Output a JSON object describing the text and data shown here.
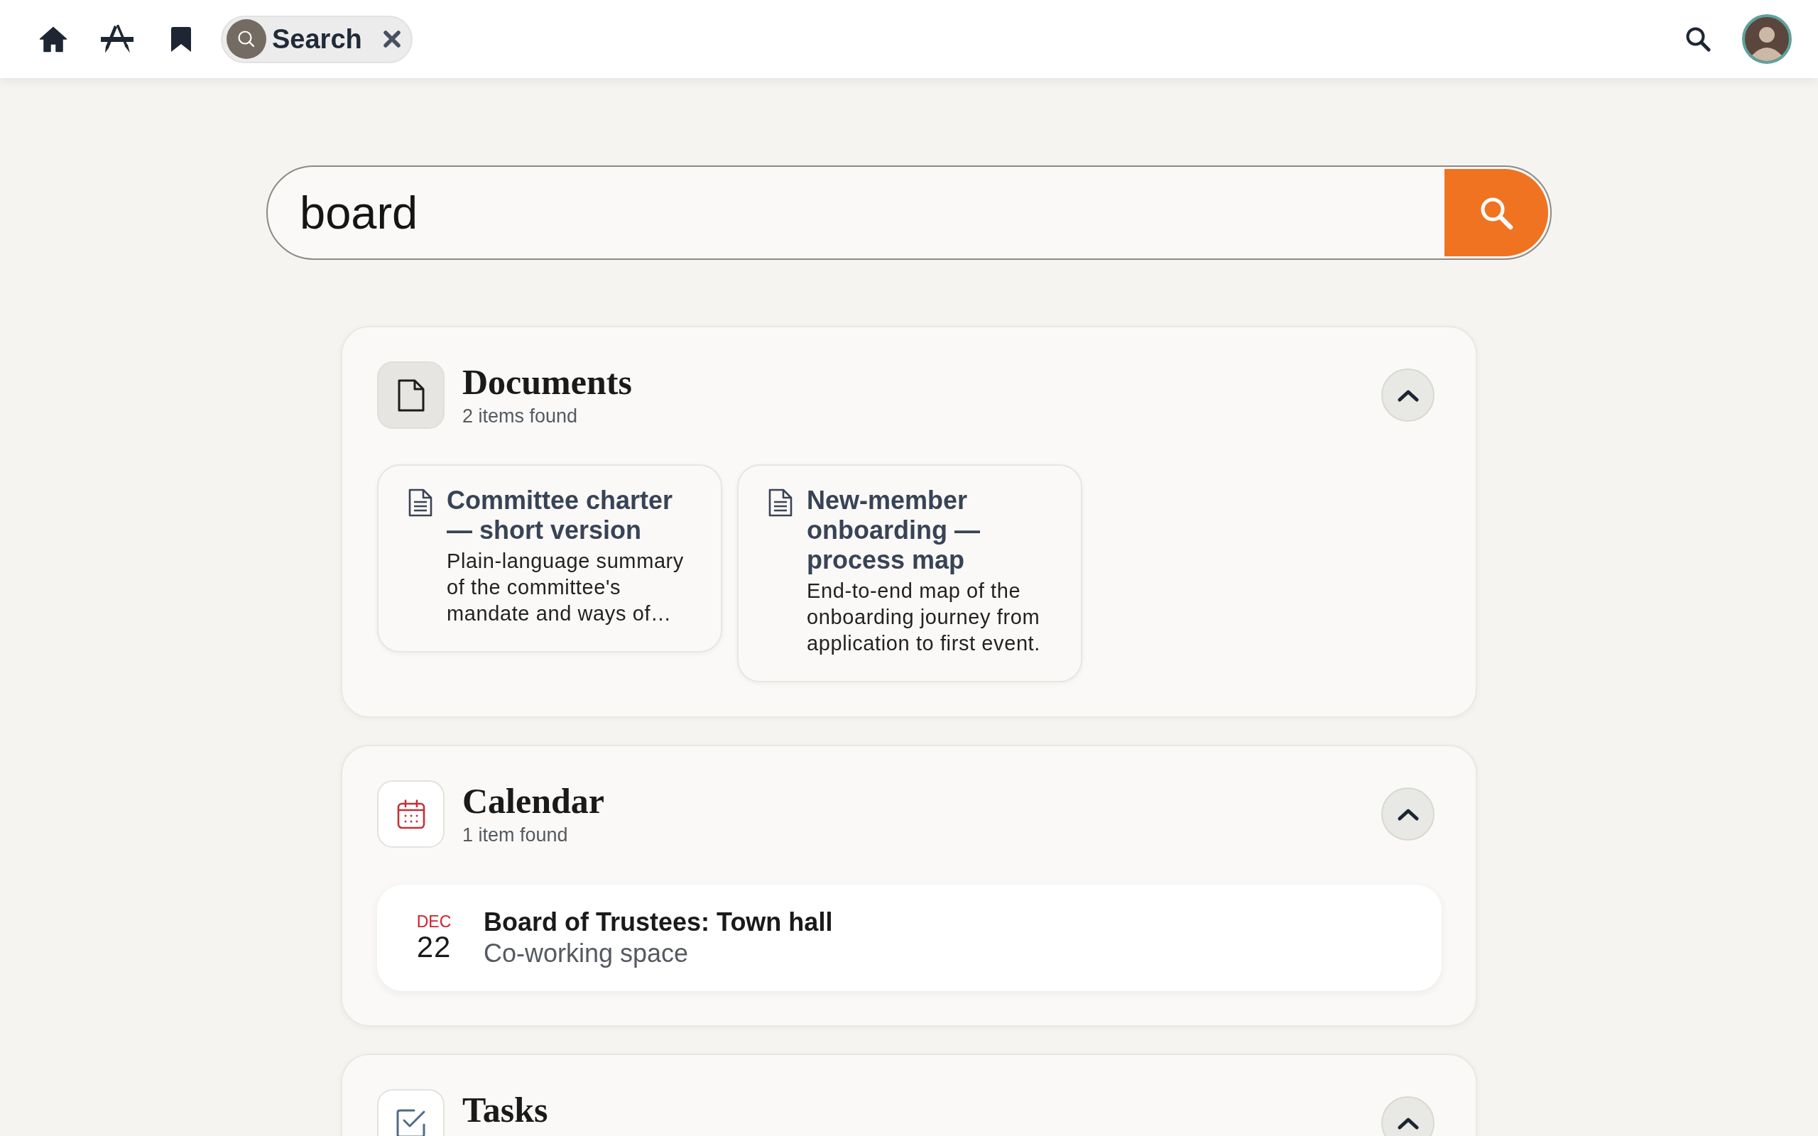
{
  "topbar": {
    "search_tab": {
      "label": "Search"
    }
  },
  "search": {
    "value": "board"
  },
  "sections": [
    {
      "kind": "documents",
      "title": "Documents",
      "count": "2 items found",
      "expanded": true,
      "items": [
        {
          "title": "Committee charter — short version",
          "description": "Plain-language summary of the committee's mandate and ways of…"
        },
        {
          "title": "New-member onboarding — process map",
          "description": "End-to-end map of the onboarding journey from application to first event."
        }
      ]
    },
    {
      "kind": "calendar",
      "title": "Calendar",
      "count": "1 item found",
      "expanded": true,
      "items": [
        {
          "month": "DEC",
          "day": "22",
          "title": "Board of Trustees: Town hall",
          "location": "Co-working space"
        }
      ]
    },
    {
      "kind": "tasks",
      "title": "Tasks",
      "expanded": true
    }
  ]
}
